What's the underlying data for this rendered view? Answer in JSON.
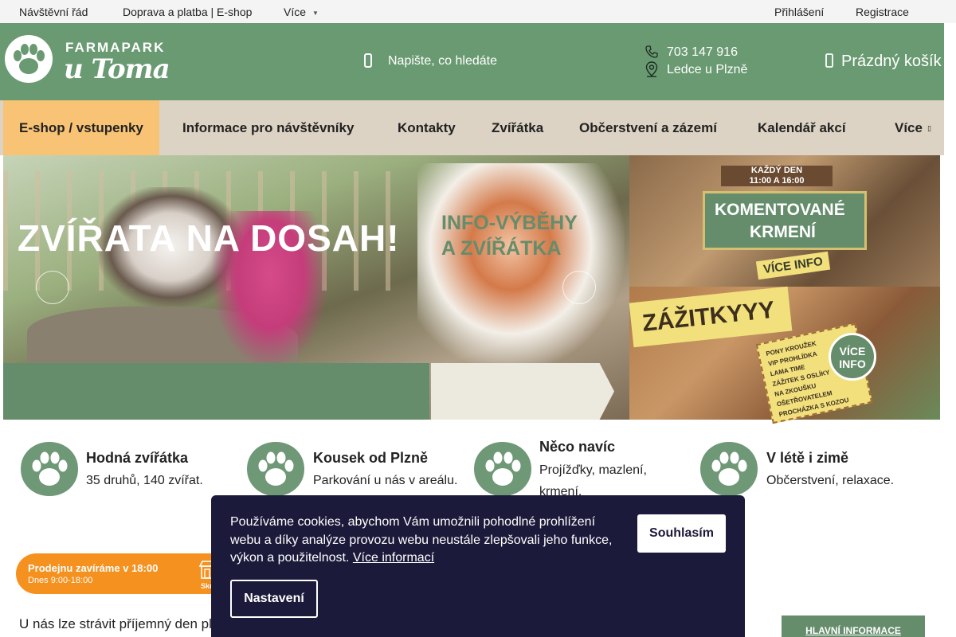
{
  "topbar": {
    "links": [
      {
        "label": "Návštěvní řád"
      },
      {
        "label": "Doprava a platba | E-shop"
      },
      {
        "label": "Více"
      }
    ],
    "login": "Přihlášení",
    "register": "Registrace"
  },
  "header": {
    "logo_small": "FARMAPARK",
    "logo_big": "u Toma",
    "search_placeholder": "Napište, co hledáte",
    "phone": "703 147 916",
    "address": "Ledce u Plzně",
    "cart": "Prázdný košík"
  },
  "nav": {
    "items": [
      {
        "label": "E-shop / vstupenky",
        "active": true
      },
      {
        "label": "Informace pro návštěvníky"
      },
      {
        "label": "Kontakty"
      },
      {
        "label": "Zvířátka"
      },
      {
        "label": "Občerstvení a zázemí"
      },
      {
        "label": "Kalendář akcí"
      },
      {
        "label": "Více"
      }
    ]
  },
  "banners": {
    "main_title": "ZVÍŘATA NA DOSAH!",
    "main_info_line1": "INFO-VÝBĚHY",
    "main_info_line2": "A ZVÍŘÁTKA",
    "side1_badge_line1": "KAŽDÝ DEN",
    "side1_badge_line2": "11:00 A 16:00",
    "side1_title_line1": "KOMENTOVANÉ",
    "side1_title_line2": "KRMENÍ",
    "side1_more": "VÍCE INFO",
    "side2_title": "ZÁŽITKYYY",
    "side2_items": [
      "PONY KROUŽEK",
      "VIP PROHLÍDKA",
      "LAMA TIME",
      "ZÁŽITEK S OSLÍKY",
      "NA ZKOUŠKU OŠETŘOVATELEM",
      "PROCHÁZKA S KOZOU"
    ],
    "side2_more_line1": "VÍCE",
    "side2_more_line2": "INFO"
  },
  "features": [
    {
      "title": "Hodná zvířátka",
      "sub": "35 druhů, 140 zvířat."
    },
    {
      "title": "Kousek od Plzně",
      "sub": "Parkování u nás v areálu."
    },
    {
      "title": "Něco navíc",
      "sub": "Projížďky, mazlení, krmení."
    },
    {
      "title": "V létě i zimě",
      "sub": "Občerstvení, relaxace."
    }
  ],
  "body_text": "U nás lze strávit příjemný den plný",
  "main_info_button": "HLAVNÍ INFORMACE",
  "closing": {
    "title": "Prodejnu zavíráme v 18:00",
    "hours": "Dnes 9:00-18:00",
    "hide": "Skrýt"
  },
  "cookie": {
    "text": "Používáme cookies, abychom Vám umožnili pohodlné prohlížení webu a díky analýze provozu webu neustále zlepšovali jeho funkce, výkon a použitelnost.",
    "link": "Více informací",
    "accept": "Souhlasím",
    "settings": "Nastavení"
  },
  "colors": {
    "brand_green": "#6a9a72",
    "nav_bg": "#ddd3c4",
    "active_tab": "#f8c374",
    "cookie_bg": "#1c1a3a",
    "closing_orange": "#f5911e"
  }
}
